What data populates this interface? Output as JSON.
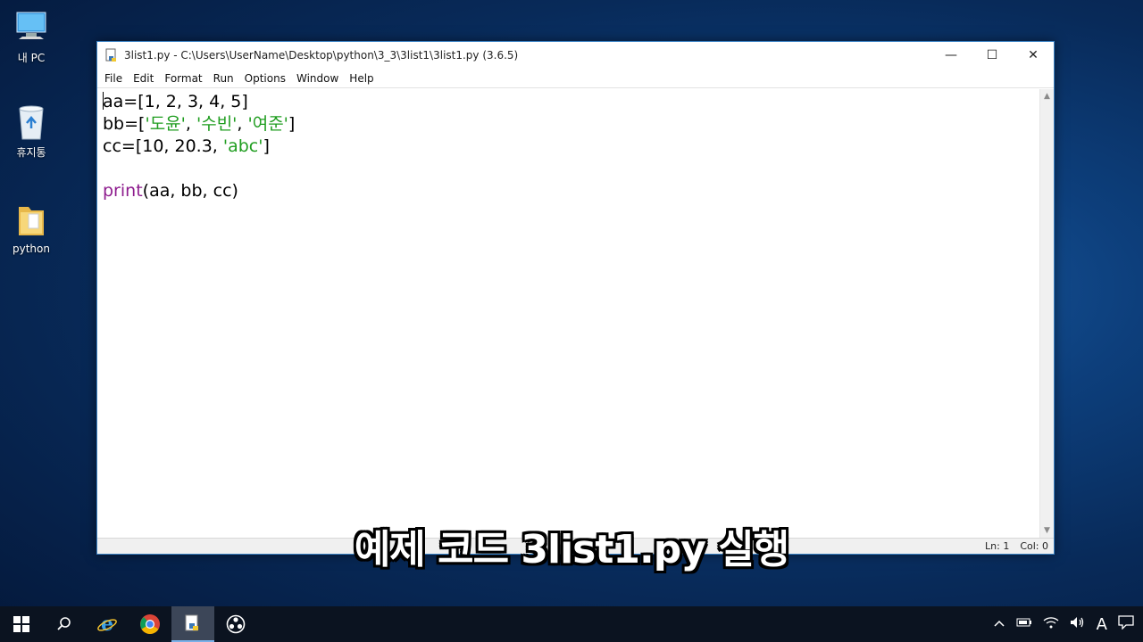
{
  "desktop": {
    "icons": [
      {
        "label": "내 PC",
        "icon": "pc-icon"
      },
      {
        "label": "휴지통",
        "icon": "recycle-bin-icon"
      },
      {
        "label": "python",
        "icon": "folder-icon"
      }
    ]
  },
  "window": {
    "title": "3list1.py - C:\\Users\\UserName\\Desktop\\python\\3_3\\3list1\\3list1.py (3.6.5)",
    "controls": {
      "minimize": "—",
      "maximize": "☐",
      "close": "✕"
    },
    "menu": [
      "File",
      "Edit",
      "Format",
      "Run",
      "Options",
      "Window",
      "Help"
    ],
    "code": {
      "l1": "aa=[1, 2, 3, 4, 5]",
      "l2_a": "bb=[",
      "l2_s1": "'도윤'",
      "l2_sep1": ", ",
      "l2_s2": "'수빈'",
      "l2_sep2": ", ",
      "l2_s3": "'여준'",
      "l2_b": "]",
      "l3_a": "cc=[10, 20.3, ",
      "l3_s": "'abc'",
      "l3_b": "]",
      "l5_kw": "print",
      "l5_rest": "(aa, bb, cc)"
    },
    "status": {
      "line": "Ln: 1",
      "col": "Col: 0"
    }
  },
  "subtitle": "예제 코드 3list1.py 실행",
  "taskbar": {
    "buttons": [
      "start-icon",
      "search-icon",
      "edge-icon",
      "chrome-icon",
      "idle-icon",
      "obs-icon"
    ],
    "tray_ime": "A"
  },
  "colors": {
    "string": "#1f9d1f",
    "keyword": "#8e1d8e",
    "taskbar": "#0b1320"
  }
}
